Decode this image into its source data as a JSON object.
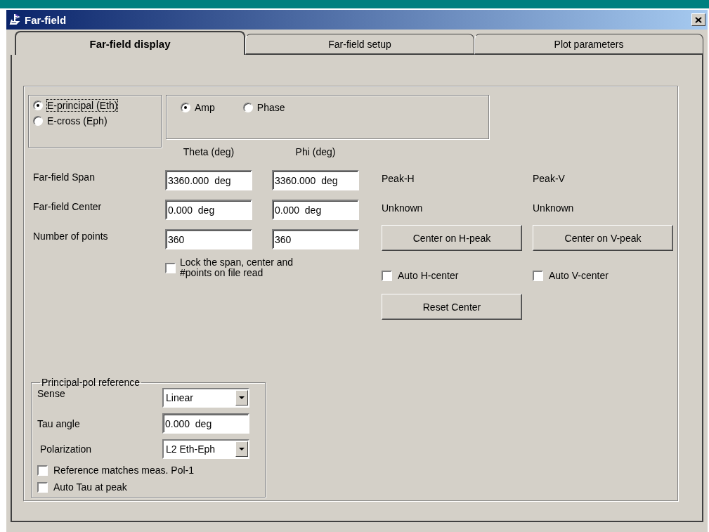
{
  "window": {
    "title": "Far-field"
  },
  "tabs": [
    {
      "label": "Far-field display",
      "selected": true
    },
    {
      "label": "Far-field setup",
      "selected": false
    },
    {
      "label": "Plot parameters",
      "selected": false
    }
  ],
  "component_options": [
    {
      "label": "E-principal (Eth)",
      "selected": true,
      "focused": true
    },
    {
      "label": "E-cross (Eph)",
      "selected": false,
      "focused": false
    }
  ],
  "display_options": [
    {
      "label": "Amp",
      "selected": true
    },
    {
      "label": "Phase",
      "selected": false
    }
  ],
  "columns": [
    "Theta (deg)",
    "Phi (deg)"
  ],
  "fields": [
    {
      "label": "Far-field Span",
      "theta": "3360.000  deg",
      "phi": "3360.000  deg"
    },
    {
      "label": "Far-field Center",
      "theta": "0.000  deg",
      "phi": "0.000  deg"
    },
    {
      "label": "Number of points",
      "theta": "360",
      "phi": "360"
    }
  ],
  "lock_checkbox": {
    "label": "Lock the span, center and #points on file read",
    "checked": false
  },
  "peaks": [
    {
      "label": "Peak-H",
      "status": "Unknown",
      "button": "Center on H-peak",
      "auto_label": "Auto H-center",
      "auto_checked": false
    },
    {
      "label": "Peak-V",
      "status": "Unknown",
      "button": "Center on V-peak",
      "auto_label": "Auto V-center",
      "auto_checked": false
    }
  ],
  "reset_button": "Reset Center",
  "pol_reference": {
    "title": "Principal-pol reference",
    "sense": {
      "label": "Sense",
      "value": "Linear"
    },
    "tau": {
      "label": "Tau angle",
      "value": "0.000  deg"
    },
    "polarization": {
      "label": "Polarization",
      "value": "L2 Eth-Eph"
    },
    "checkboxes": [
      {
        "label": "Reference matches meas. Pol-1",
        "checked": false
      },
      {
        "label": "Auto Tau at peak",
        "checked": false
      }
    ]
  }
}
